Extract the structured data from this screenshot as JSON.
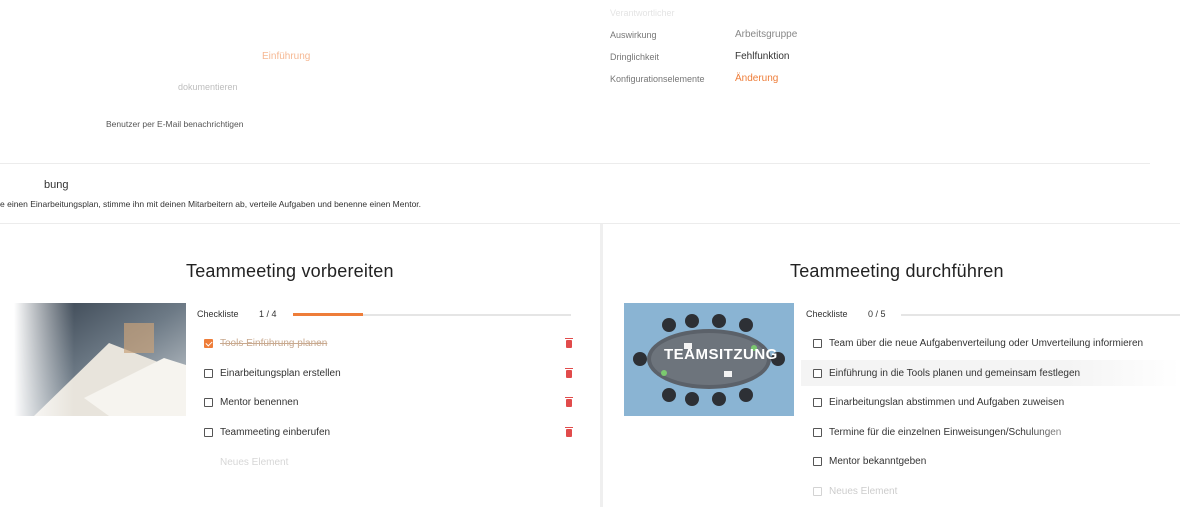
{
  "top_left": {
    "orange_link": "Einführung",
    "faded_line": "dokumentieren",
    "notify_text": "Benutzer per E-Mail benachrichtigen"
  },
  "meta": {
    "header_faded": "Verantwortlicher",
    "rows": [
      {
        "label": "Auswirkung",
        "value": "Arbeitsgruppe"
      },
      {
        "label": "Dringlichkeit",
        "value": "Fehlfunktion"
      },
      {
        "label": "Konfigurationselemente",
        "value": "Änderung"
      }
    ]
  },
  "description": {
    "title": "bung",
    "text": "e einen Einarbeitungsplan, stimme ihn mit deinen Mitarbeitern ab, verteile Aufgaben und benenne einen Mentor."
  },
  "cards": [
    {
      "title": "Teammeeting vorbereiten",
      "checklist_label": "Checkliste",
      "count": "1 / 4",
      "progress": 0.25,
      "items": [
        {
          "text": "Tools Einführung planen",
          "done": true
        },
        {
          "text": "Einarbeitungsplan erstellen",
          "done": false
        },
        {
          "text": "Mentor benennen",
          "done": false
        },
        {
          "text": "Teammeeting einberufen",
          "done": false
        }
      ],
      "new_item": "Neues Element"
    },
    {
      "title": "Teammeeting durchführen",
      "checklist_label": "Checkliste",
      "count": "0 / 5",
      "progress": 0,
      "image_text": "TEAMSITZUNG",
      "items": [
        {
          "text": "Team über die neue Aufgabenverteilung oder Umverteilung informieren",
          "done": false
        },
        {
          "text": "Einführung in die Tools planen und gemeinsam festlegen",
          "done": false
        },
        {
          "text": "Einarbeitungslan abstimmen und Aufgaben zuweisen",
          "done": false
        },
        {
          "text": "Termine für die einzelnen Einweisungen/Schulungen",
          "done": false
        },
        {
          "text": "Mentor bekanntgeben",
          "done": false
        }
      ],
      "new_item": "Neues Element"
    }
  ],
  "colors": {
    "accent": "#ee7d39",
    "delete": "#e14b4b",
    "image_bg": "#8ab4d3"
  }
}
